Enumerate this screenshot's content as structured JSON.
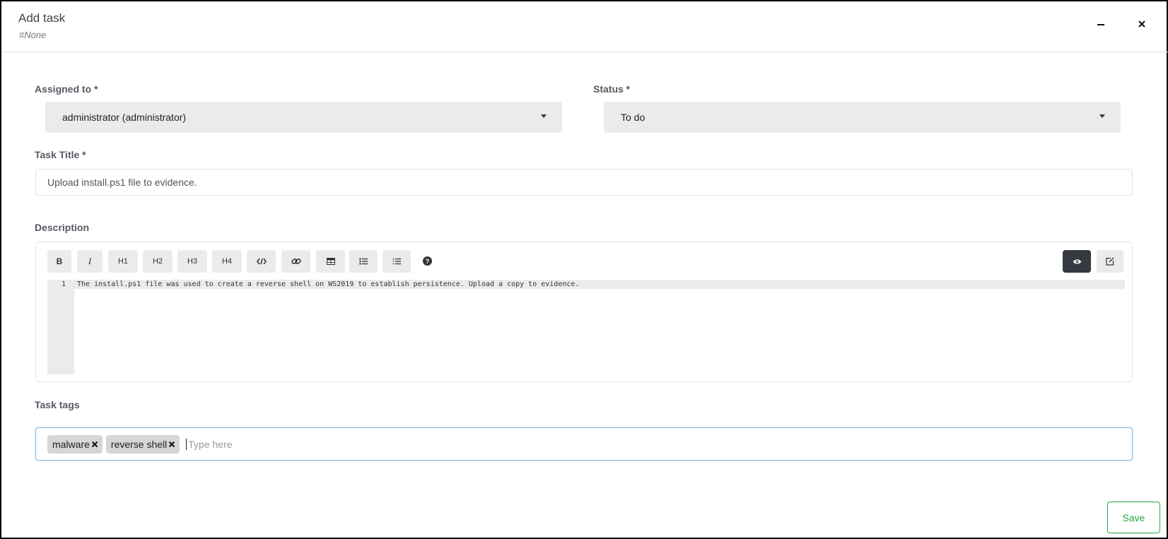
{
  "modal": {
    "title": "Add task",
    "subtitle": "#None"
  },
  "fields": {
    "assigned_label": "Assigned to *",
    "assigned_value": "administrator (administrator)",
    "status_label": "Status *",
    "status_value": "To do",
    "title_label": "Task Title *",
    "title_value": "Upload install.ps1 file to evidence.",
    "description_label": "Description",
    "tags_label": "Task tags"
  },
  "toolbar": {
    "bold": "B",
    "italic": "I",
    "h1": "H1",
    "h2": "H2",
    "h3": "H3",
    "h4": "H4",
    "help": "?"
  },
  "editor": {
    "line_number": "1",
    "content": "The install.ps1 file was used to create a reverse shell on WS2019 to establish persistence. Upload a copy to evidence."
  },
  "tags": {
    "items": [
      "malware",
      "reverse shell"
    ],
    "placeholder": "Type here"
  },
  "actions": {
    "save": "Save"
  },
  "colors": {
    "save_green": "#28a745",
    "dark_button": "#343a40",
    "field_bg": "#ebebeb",
    "focus_border": "#7fbde7"
  },
  "icons": {
    "minimize": "minimize-icon",
    "close": "close-icon",
    "code": "code-icon",
    "link": "link-icon",
    "table": "table-icon",
    "bullet_list": "bullet-list-icon",
    "ordered_list": "ordered-list-icon",
    "help": "help-icon",
    "preview": "eye-icon",
    "edit": "edit-icon",
    "tag_remove": "close-icon"
  }
}
